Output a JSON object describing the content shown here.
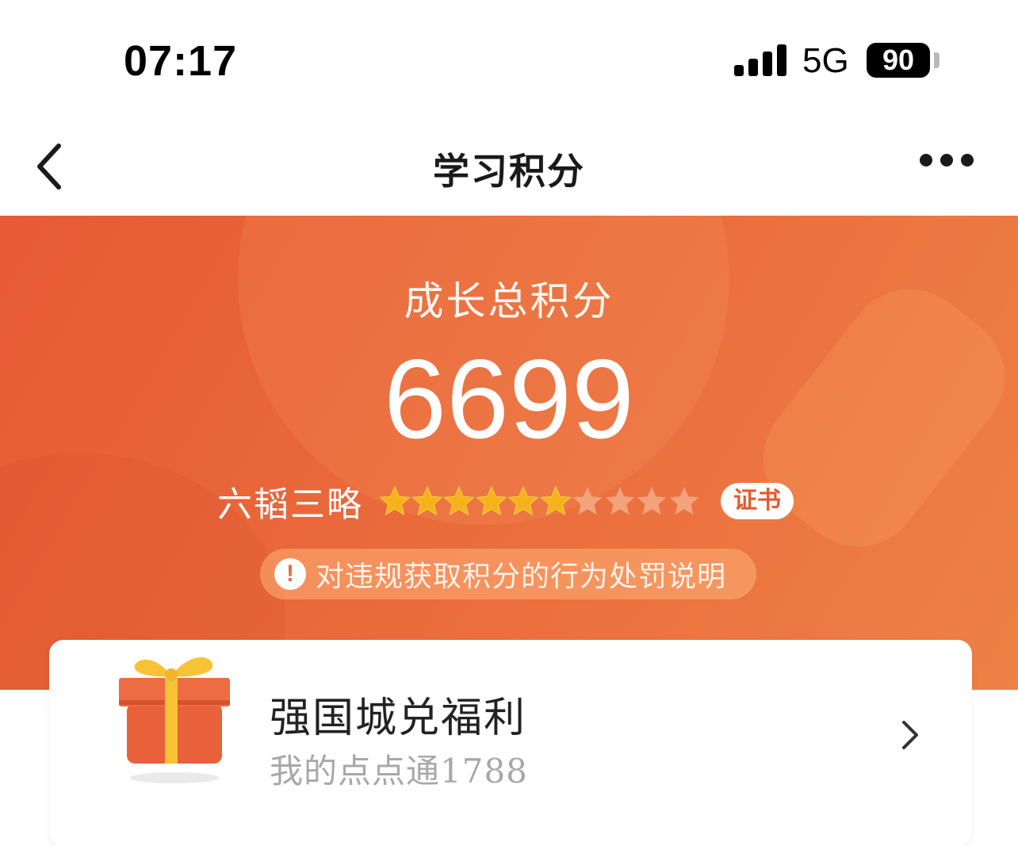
{
  "status_bar": {
    "time": "07:17",
    "network": "5G",
    "battery": "90",
    "signal_bars": 4
  },
  "nav": {
    "title": "学习积分",
    "back_icon": "chevron-left-icon",
    "more_icon": "more-dots-icon"
  },
  "hero": {
    "label": "成长总积分",
    "score": "6699",
    "rank_name": "六韬三略",
    "stars_total": 10,
    "stars_filled": 6,
    "certificate_label": "证书",
    "notice_text": "对违规获取积分的行为处罚说明",
    "notice_icon": "exclamation-icon"
  },
  "reward_card": {
    "title": "强国城兑福利",
    "subtitle": "我的点点通1788",
    "icon": "gift-icon",
    "chevron_icon": "chevron-right-icon"
  },
  "colors": {
    "hero_orange": "#ea6a3c",
    "star_gold": "#f6b21b",
    "star_empty": "#f3a27d"
  }
}
